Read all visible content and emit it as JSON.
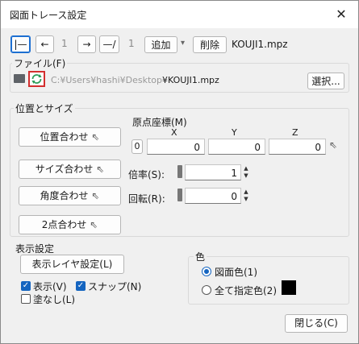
{
  "window": {
    "title": "図面トレース設定",
    "close": "✕"
  },
  "toolbar": {
    "first_label": "|—",
    "back_label": "←",
    "count_a": "1",
    "forward_label": "→",
    "last_label": "—/",
    "count_b": "1",
    "add_label": "追加",
    "add_dropdown": "▾",
    "delete_label": "削除",
    "current_file": "KOUJI1.mpz"
  },
  "file": {
    "label": "ファイル(F)",
    "path_dim": "C:¥Users¥hashi¥Desktop",
    "path_name": "¥KOUJI1.mpz",
    "select_label": "選択..."
  },
  "position": {
    "label": "位置とサイズ",
    "align_pos_label": "位置合わせ",
    "align_size_label": "サイズ合わせ",
    "align_angle_label": "角度合わせ",
    "align_2pt_label": "2点合わせ",
    "origin_label": "原点座標(M)",
    "x_label": "X",
    "y_label": "Y",
    "z_label": "Z",
    "origin_index": "0",
    "x_value": "0",
    "y_value": "0",
    "z_value": "0",
    "scale_label": "倍率(S):",
    "scale_value": "1",
    "rotate_label": "回転(R):",
    "rotate_value": "0"
  },
  "display": {
    "label": "表示設定",
    "layer_button": "表示レイヤ設定(L)",
    "show_label": "表示(V)",
    "show_checked": true,
    "snap_label": "スナップ(N)",
    "snap_checked": true,
    "fill_none_label": "塗なし(L)",
    "fill_none_checked": false
  },
  "color": {
    "label": "色",
    "drawing_color_label": "図面色(1)",
    "all_specified_label": "全て指定色(2)",
    "swatch": "#000000",
    "accent": "#1565c0"
  },
  "footer": {
    "close_label": "閉じる(C)"
  }
}
